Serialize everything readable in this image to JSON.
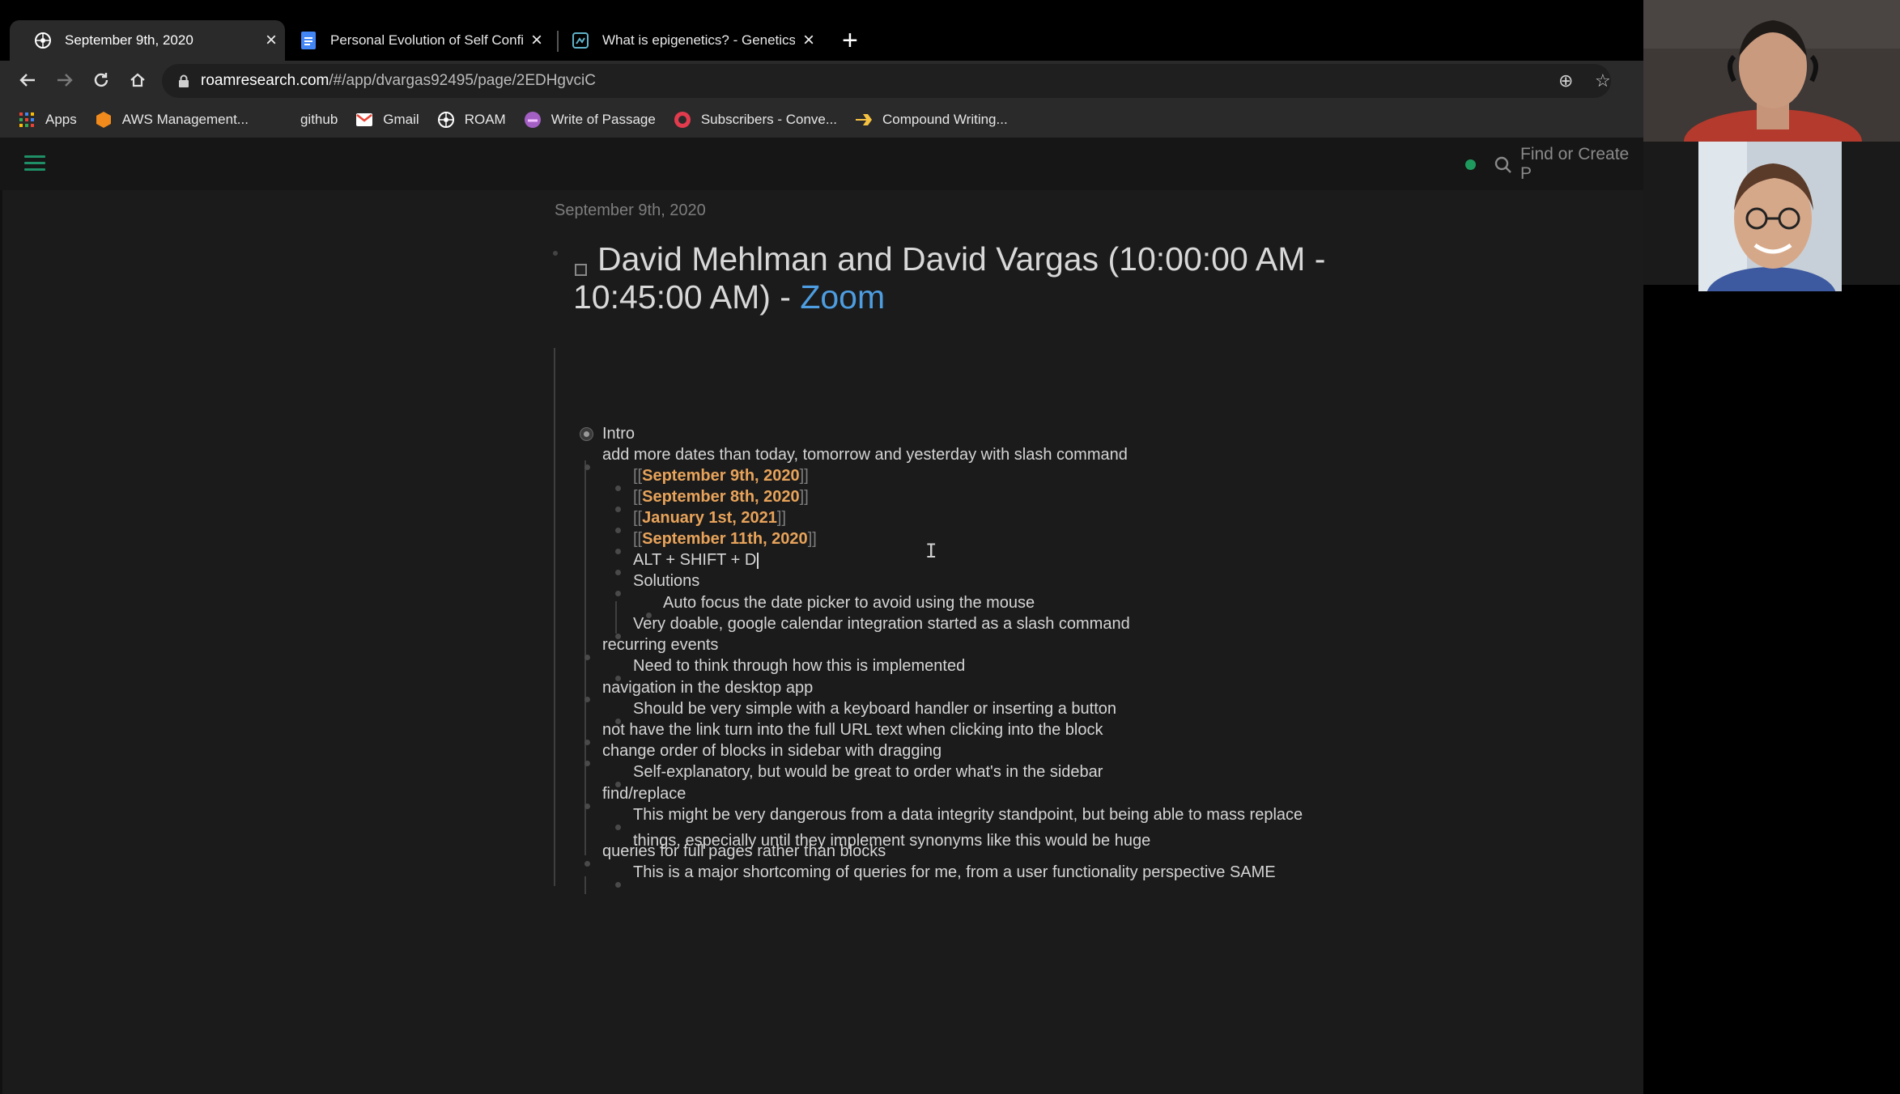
{
  "browser": {
    "tabs": [
      {
        "title": "September 9th, 2020",
        "active": true
      },
      {
        "title": "Personal Evolution of Self Confid",
        "active": false
      },
      {
        "title": "What is epigenetics? - Genetics H",
        "active": false
      }
    ],
    "url_host": "roamresearch.com",
    "url_path": "/#/app/dvargas92495/page/2EDHgvciC",
    "bookmarks": [
      {
        "label": "Apps",
        "icon": "apps-grid-icon"
      },
      {
        "label": "AWS Management...",
        "icon": "aws-icon"
      },
      {
        "label": "github",
        "icon": "github-icon"
      },
      {
        "label": "Gmail",
        "icon": "gmail-icon"
      },
      {
        "label": "ROAM",
        "icon": "roam-icon"
      },
      {
        "label": "Write of Passage",
        "icon": "write-of-passage-icon"
      },
      {
        "label": "Subscribers - Conve...",
        "icon": "convertkit-icon"
      },
      {
        "label": "Compound Writing...",
        "icon": "compound-writing-icon"
      }
    ]
  },
  "roam": {
    "search_placeholder": "Find or Create P",
    "page_date": "September 9th, 2020",
    "title_prefix": "David Mehlman and David Vargas (10:00:00 AM - 10:45:00 AM) - ",
    "title_link": "Zoom",
    "blocks": {
      "intro": "Intro",
      "dates": "add more dates than today, tomorrow and yesterday with slash command",
      "date1": "September 9th, 2020",
      "date2": "September 8th, 2020",
      "date3": "January 1st, 2021",
      "date4": "September 11th, 2020",
      "shortcut": "ALT + SHIFT + D",
      "solutions": "Solutions",
      "autofocus": "Auto focus the date picker to avoid using the mouse",
      "doable": "Very doable, google calendar integration started as a slash command",
      "recurring": "recurring events",
      "recurring_sub": "Need to think through how this is implemented",
      "navigation": "navigation in the desktop app",
      "navigation_sub": "Should be very simple with a keyboard handler or inserting a button",
      "link_url": "not have the link turn into the full URL text when clicking into the block",
      "order": "change order of blocks in sidebar with dragging",
      "order_sub": "Self-explanatory, but would be great to order what's in the sidebar",
      "find": "find/replace",
      "find_sub_1": "This might be very dangerous from a data integrity standpoint, but being able to mass replace",
      "find_sub_2": "things, especially until they implement synonyms like this would be huge",
      "queries": "queries for full pages rather than blocks",
      "queries_sub": "This is a major shortcoming of queries for me, from a user functionality perspective SAME"
    }
  },
  "colors": {
    "date_ref": "#e8a35a",
    "link": "#4d9de0",
    "status_dot": "#1e9a5e"
  }
}
